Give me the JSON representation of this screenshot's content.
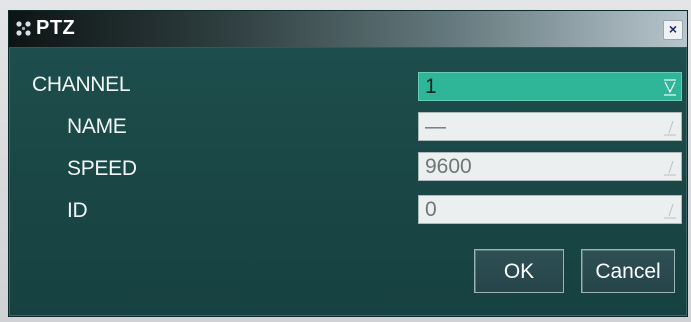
{
  "dialog": {
    "title": "PTZ",
    "close_label": "×"
  },
  "fields": {
    "channel": {
      "label": "CHANNEL",
      "value": "1"
    },
    "name": {
      "label": "NAME",
      "value": "—"
    },
    "speed": {
      "label": "SPEED",
      "value": "9600"
    },
    "id": {
      "label": "ID",
      "value": "0"
    }
  },
  "buttons": {
    "ok": "OK",
    "cancel": "Cancel"
  },
  "colors": {
    "dialog_bg": "#1e4f4e",
    "active_field": "#2fb597",
    "field_bg": "#ecefef"
  },
  "icons": {
    "title": "ptz-camera-icon",
    "dropdown": "dropdown-arrow-icon"
  }
}
